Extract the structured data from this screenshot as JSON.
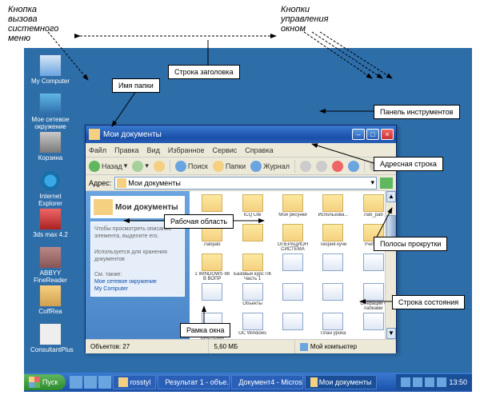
{
  "annotations": {
    "system_menu_button": "Кнопка\nвызова\nсистемного\nменю",
    "title_row": "Строка заголовка",
    "folder_name": "Имя папки",
    "window_control_buttons": "Кнопки\nуправления\nокном",
    "toolbar_panel": "Панель инструментов",
    "address_row": "Адресная строка",
    "work_area": "Рабочая область",
    "scrollbars": "Полосы прокрутки",
    "status_row": "Строка состояния",
    "window_frame": "Рамка окна"
  },
  "desktop_icons": [
    {
      "label": "My Computer",
      "cls": "comp"
    },
    {
      "label": "Мое сетевое окружение",
      "cls": "net"
    },
    {
      "label": "Корзина",
      "cls": "trash"
    },
    {
      "label": "Internet Explorer",
      "cls": "ie"
    },
    {
      "label": "3ds max 4.2",
      "cls": "max"
    },
    {
      "label": "ABBYY FineReader",
      "cls": "fine"
    },
    {
      "label": "CoffRea",
      "cls": "coff"
    },
    {
      "label": "ConsultantPlus",
      "cls": "cons"
    }
  ],
  "window": {
    "title": "Мои документы",
    "menu": [
      "Файл",
      "Правка",
      "Вид",
      "Избранное",
      "Сервис",
      "Справка"
    ],
    "toolbar": {
      "back": "Назад",
      "search": "Поиск",
      "folders": "Папки",
      "history": "Журнал"
    },
    "address_label": "Адрес:",
    "address_value": "Мои документы",
    "side_title": "Мои документы",
    "side_hint1": "Чтобы просмотреть описание элемента, выделите его.",
    "side_hint2": "Используется для хранения документов",
    "side_hint3": "См. также:",
    "side_link1": "Мое сетевое окружение",
    "side_link2": "My Computer",
    "items": [
      {
        "t": "f",
        "l": ""
      },
      {
        "t": "f",
        "l": "ICQ Lite"
      },
      {
        "t": "f",
        "l": "Мои рисунки"
      },
      {
        "t": "f",
        "l": "Использова..."
      },
      {
        "t": "f",
        "l": "Лаб_раб"
      },
      {
        "t": "f",
        "l": "Лабраб"
      },
      {
        "t": "f",
        "l": ""
      },
      {
        "t": "f",
        "l": "ОПЕРАЦИОН СИСТЕМА"
      },
      {
        "t": "f",
        "l": "Теория кучи"
      },
      {
        "t": "f",
        "l": "Учитель"
      },
      {
        "t": "f",
        "l": "1 WINDOWS 98 В ВОПР"
      },
      {
        "t": "f",
        "l": "Базовый курс ПК Часть 1"
      },
      {
        "t": "d",
        "l": ""
      },
      {
        "t": "d",
        "l": ""
      },
      {
        "t": "d",
        "l": ""
      },
      {
        "t": "d",
        "l": ""
      },
      {
        "t": "d",
        "l": "Объекты"
      },
      {
        "t": "d",
        "l": ""
      },
      {
        "t": "d",
        "l": ""
      },
      {
        "t": "d",
        "l": "Операции с папками"
      },
      {
        "t": "d",
        "l": "ОПЕРАЦИОН СИСТЕМА"
      },
      {
        "t": "d",
        "l": "ОС Windows"
      },
      {
        "t": "d",
        "l": ""
      },
      {
        "t": "d",
        "l": "План урока"
      },
      {
        "t": "d",
        "l": ""
      },
      {
        "t": "d",
        "l": ""
      },
      {
        "t": "d",
        "l": ""
      },
      {
        "t": "d",
        "l": ""
      },
      {
        "t": "d",
        "l": ""
      },
      {
        "t": "d",
        "l": ""
      }
    ],
    "status_objects": "Объектов: 27",
    "status_size": "5,60 МБ",
    "status_loc": "Мой компьютер"
  },
  "taskbar": {
    "start": "Пуск",
    "tasks": [
      {
        "label": "rosstyl"
      },
      {
        "label": "Результат 1 - объе..."
      },
      {
        "label": "Документ4 - Micros..."
      },
      {
        "label": "Мои документы"
      }
    ],
    "time": "13:50"
  }
}
